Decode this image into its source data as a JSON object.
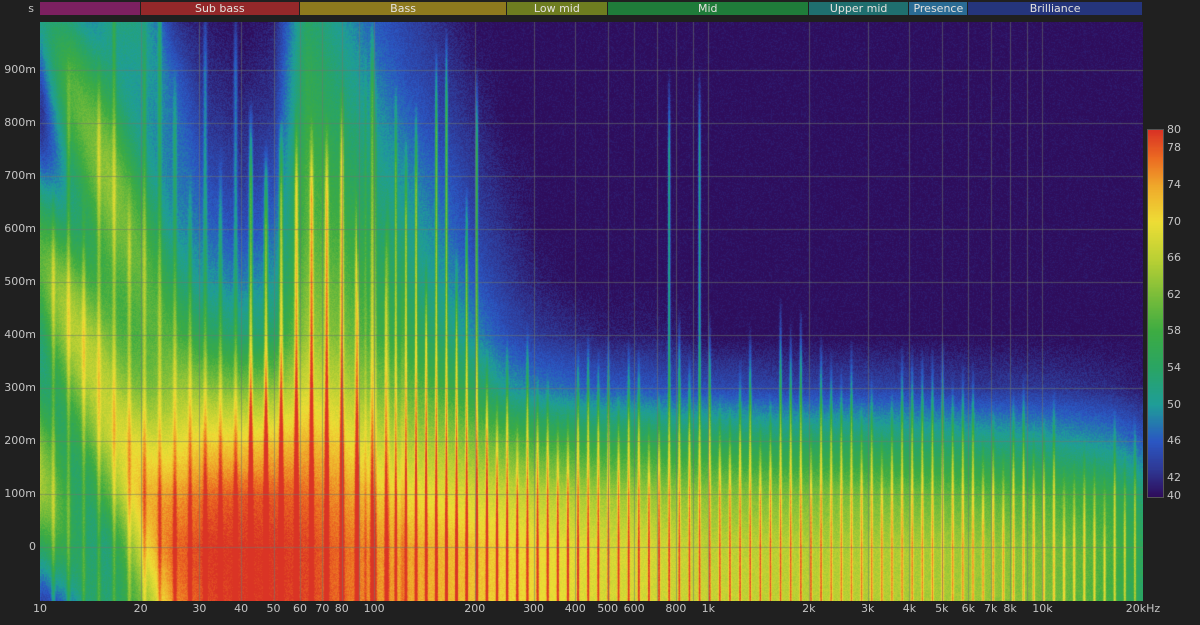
{
  "app": {
    "background": "#202020"
  },
  "chart_data": {
    "type": "heatmap",
    "subtype": "spectrogram",
    "title": "",
    "xaxis": {
      "scale": "log",
      "range_hz": [
        10,
        20000
      ],
      "ticks": [
        {
          "f": 10,
          "label": "10"
        },
        {
          "f": 20,
          "label": "20"
        },
        {
          "f": 30,
          "label": "30"
        },
        {
          "f": 40,
          "label": "40"
        },
        {
          "f": 50,
          "label": "50"
        },
        {
          "f": 60,
          "label": "60"
        },
        {
          "f": 70,
          "label": "70"
        },
        {
          "f": 80,
          "label": "80"
        },
        {
          "f": 100,
          "label": "100"
        },
        {
          "f": 200,
          "label": "200"
        },
        {
          "f": 300,
          "label": "300"
        },
        {
          "f": 400,
          "label": "400"
        },
        {
          "f": 500,
          "label": "500"
        },
        {
          "f": 600,
          "label": "600"
        },
        {
          "f": 800,
          "label": "800"
        },
        {
          "f": 1000,
          "label": "1k"
        },
        {
          "f": 2000,
          "label": "2k"
        },
        {
          "f": 3000,
          "label": "3k"
        },
        {
          "f": 4000,
          "label": "4k"
        },
        {
          "f": 5000,
          "label": "5k"
        },
        {
          "f": 6000,
          "label": "6k"
        },
        {
          "f": 7000,
          "label": "7k"
        },
        {
          "f": 8000,
          "label": "8k"
        },
        {
          "f": 10000,
          "label": "10k"
        },
        {
          "f": 20000,
          "label": "20kHz"
        }
      ],
      "grid_freqs": [
        20,
        30,
        40,
        50,
        60,
        70,
        80,
        90,
        100,
        200,
        300,
        400,
        500,
        600,
        700,
        800,
        900,
        1000,
        2000,
        3000,
        4000,
        5000,
        6000,
        7000,
        8000,
        9000,
        10000,
        20000
      ]
    },
    "yaxis": {
      "unit": "s",
      "range_s": [
        -0.1,
        1.0
      ],
      "ticks": [
        {
          "t": 0.0,
          "label": "0"
        },
        {
          "t": 0.1,
          "label": "100m"
        },
        {
          "t": 0.2,
          "label": "200m"
        },
        {
          "t": 0.3,
          "label": "300m"
        },
        {
          "t": 0.4,
          "label": "400m"
        },
        {
          "t": 0.5,
          "label": "500m"
        },
        {
          "t": 0.6,
          "label": "600m"
        },
        {
          "t": 0.7,
          "label": "700m"
        },
        {
          "t": 0.8,
          "label": "800m"
        },
        {
          "t": 0.9,
          "label": "900m"
        }
      ]
    },
    "colorbar": {
      "range_db": [
        40,
        80
      ],
      "tick_labels": [
        "80",
        "78",
        "74",
        "70",
        "66",
        "62",
        "58",
        "54",
        "50",
        "46",
        "42",
        "40"
      ],
      "tick_values": [
        80,
        78,
        74,
        70,
        66,
        62,
        58,
        54,
        50,
        46,
        42,
        40
      ],
      "stops": [
        {
          "v": 40,
          "c": "#2e0d5c"
        },
        {
          "v": 43,
          "c": "#2f3a96"
        },
        {
          "v": 46,
          "c": "#2b57c4"
        },
        {
          "v": 50,
          "c": "#1f9e99"
        },
        {
          "v": 54,
          "c": "#2aa565"
        },
        {
          "v": 58,
          "c": "#3dac43"
        },
        {
          "v": 62,
          "c": "#7cbe3a"
        },
        {
          "v": 66,
          "c": "#bcd134"
        },
        {
          "v": 70,
          "c": "#eede36"
        },
        {
          "v": 74,
          "c": "#f0a82b"
        },
        {
          "v": 77,
          "c": "#ec6a22"
        },
        {
          "v": 80,
          "c": "#da3425"
        }
      ]
    },
    "bands": [
      {
        "label": "",
        "range_hz": [
          10,
          20
        ],
        "color": "#7c2060"
      },
      {
        "label": "Sub bass",
        "range_hz": [
          20,
          60
        ],
        "color": "#94282a"
      },
      {
        "label": "Bass",
        "range_hz": [
          60,
          250
        ],
        "color": "#8e7a1e"
      },
      {
        "label": "Low mid",
        "range_hz": [
          250,
          500
        ],
        "color": "#6e7d20"
      },
      {
        "label": "Mid",
        "range_hz": [
          500,
          2000
        ],
        "color": "#1f7c3a"
      },
      {
        "label": "Upper mid",
        "range_hz": [
          2000,
          4000
        ],
        "color": "#1f6f6f"
      },
      {
        "label": "Presence",
        "range_hz": [
          4000,
          6000
        ],
        "color": "#2a6b94"
      },
      {
        "label": "Brilliance",
        "range_hz": [
          6000,
          20000
        ],
        "color": "#25357c"
      }
    ],
    "grid": {
      "freqs": [
        10,
        12.5,
        16,
        20,
        25,
        31.5,
        40,
        50,
        63,
        80,
        100,
        125,
        160,
        200,
        250,
        315,
        400,
        500,
        630,
        800,
        1000,
        1600,
        2500,
        4000,
        6300,
        10000,
        16000,
        20000
      ],
      "times": [
        -0.1,
        0,
        0.1,
        0.2,
        0.3,
        0.4,
        0.5,
        0.6,
        0.7,
        0.8,
        0.9,
        1.0
      ],
      "values_db": [
        [
          50,
          46,
          52,
          64,
          74,
          79,
          80,
          80,
          79,
          77,
          75,
          74,
          73,
          72,
          71,
          70,
          69,
          68,
          68,
          67,
          67,
          66,
          66,
          65,
          64,
          62,
          58,
          54
        ],
        [
          54,
          50,
          56,
          68,
          76,
          80,
          80,
          80,
          79,
          77,
          75,
          74,
          73,
          72,
          71,
          70,
          69,
          68,
          68,
          67,
          66,
          66,
          65,
          65,
          64,
          62,
          59,
          55
        ],
        [
          58,
          56,
          62,
          70,
          75,
          77,
          78,
          78,
          77,
          75,
          72,
          70,
          69,
          68,
          67,
          66,
          65,
          64,
          64,
          63,
          63,
          62,
          62,
          61,
          60,
          59,
          57,
          53
        ],
        [
          60,
          60,
          64,
          68,
          70,
          71,
          71,
          72,
          73,
          71,
          67,
          65,
          64,
          62,
          60,
          58,
          57,
          56,
          56,
          55,
          55,
          54,
          54,
          53,
          52,
          51,
          49,
          46
        ],
        [
          59,
          61,
          63,
          64,
          64,
          63,
          62,
          63,
          68,
          66,
          62,
          60,
          58,
          55,
          50,
          48,
          47,
          46,
          46,
          45,
          45,
          44,
          44,
          44,
          43,
          43,
          42,
          41
        ],
        [
          57,
          61,
          63,
          61,
          58,
          55,
          53,
          54,
          64,
          62,
          58,
          56,
          53,
          49,
          45,
          43,
          42,
          41,
          41,
          41,
          40,
          40,
          40,
          40,
          40,
          40,
          40,
          40
        ],
        [
          55,
          60,
          62,
          59,
          54,
          50,
          48,
          50,
          62,
          60,
          56,
          53,
          50,
          46,
          43,
          41,
          40,
          40,
          40,
          40,
          40,
          40,
          40,
          40,
          40,
          40,
          40,
          40
        ],
        [
          52,
          58,
          61,
          57,
          51,
          47,
          45,
          47,
          60,
          58,
          54,
          51,
          48,
          44,
          42,
          40,
          40,
          40,
          40,
          40,
          40,
          40,
          40,
          40,
          40,
          40,
          40,
          40
        ],
        [
          50,
          57,
          60,
          55,
          49,
          45,
          43,
          45,
          59,
          56,
          52,
          49,
          46,
          43,
          41,
          40,
          40,
          40,
          40,
          40,
          40,
          40,
          40,
          40,
          40,
          40,
          40,
          40
        ],
        [
          48,
          56,
          58,
          53,
          47,
          43,
          42,
          43,
          57,
          54,
          50,
          47,
          44,
          42,
          40,
          40,
          40,
          40,
          40,
          40,
          40,
          40,
          40,
          40,
          40,
          40,
          40,
          40
        ],
        [
          46,
          54,
          56,
          51,
          45,
          42,
          41,
          42,
          56,
          52,
          48,
          45,
          43,
          41,
          40,
          40,
          40,
          40,
          40,
          40,
          40,
          40,
          40,
          40,
          40,
          40,
          40,
          40
        ],
        [
          45,
          52,
          54,
          49,
          43,
          41,
          40,
          41,
          54,
          50,
          46,
          44,
          42,
          40,
          40,
          40,
          40,
          40,
          40,
          40,
          40,
          40,
          40,
          40,
          40,
          40,
          40,
          40
        ]
      ]
    }
  }
}
